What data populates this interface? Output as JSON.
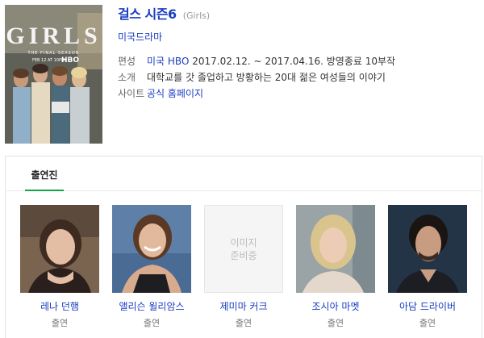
{
  "show": {
    "title": "걸스 시즌6",
    "title_original": "(Girls)",
    "genre": "미국드라마",
    "poster": {
      "logo_text": "GIRLS",
      "tagline": "THE FINAL SEASON",
      "date_text": "FEB 12 AT 10PM",
      "network": "HBO"
    },
    "meta": {
      "label_broadcast": "편성",
      "broadcast_link": "미국 HBO",
      "broadcast_detail": "2017.02.12. ~ 2017.04.16. 방영종료 10부작",
      "label_summary": "소개",
      "summary": "대학교를 갓 졸업하고 방황하는 20대 젊은 여성들의 이야기",
      "label_site": "사이트",
      "site_link": "공식 홈페이지"
    }
  },
  "cast_section": {
    "tab_label": "출연진",
    "no_image_text": "이미지\n준비중",
    "members": [
      {
        "name": "레나 던햄",
        "role": "출연"
      },
      {
        "name": "앨리슨 윌리암스",
        "role": "출연"
      },
      {
        "name": "제미마 커크",
        "role": "출연"
      },
      {
        "name": "조시아 마멧",
        "role": "출연"
      },
      {
        "name": "아담 드라이버",
        "role": "출연"
      }
    ]
  },
  "colors": {
    "link": "#1a3dc1",
    "tab_underline": "#19a14a"
  }
}
